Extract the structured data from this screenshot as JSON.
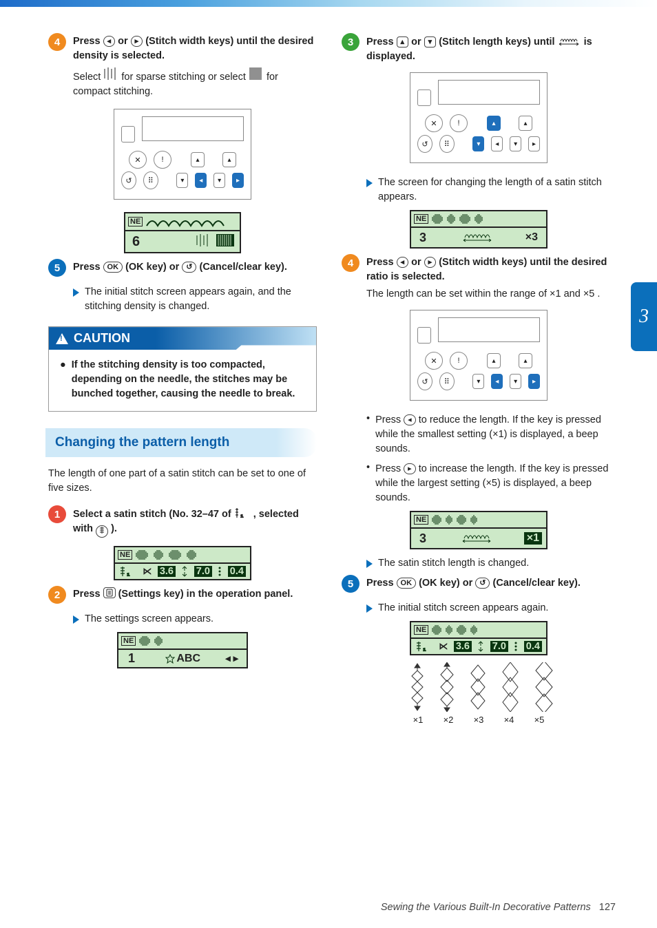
{
  "title": "Sewing machine manual page",
  "side_tab": "3",
  "footer": {
    "text": "Sewing the Various Built-In Decorative Patterns",
    "page": "127"
  },
  "left": {
    "step4": {
      "head_a": "Press ",
      "head_b": " or ",
      "head_c": " (Stitch width keys) until the desired density is selected.",
      "body_a": "Select ",
      "body_b": " for sparse stitching or select ",
      "body_c": " for compact stitching."
    },
    "lcd_density": {
      "label": "NE",
      "value": "6"
    },
    "step5": {
      "head_a": "Press ",
      "head_b": " (OK key) or ",
      "head_c": " (Cancel/clear key).",
      "ok": "OK",
      "cancel": "↺"
    },
    "step5_result": "The initial stitch screen appears again, and the stitching density is changed.",
    "caution": {
      "title": "CAUTION",
      "item1": "If the stitching density is too compacted, depending on the needle, the stitches may be bunched together, causing the needle to break."
    },
    "section_title": "Changing the pattern length",
    "intro": "The length of one part of a satin stitch can be set to one of five sizes.",
    "r_step1": {
      "head_a": "Select a satin stitch (No. 32–47 of ",
      "head_b": " , selected with ",
      "head_c": " )."
    },
    "lcd_stitch": {
      "label": "NE",
      "val_a": "3.6",
      "val_b": "7.0",
      "val_c": "0.4"
    },
    "r_step2": {
      "head_a": "Press ",
      "head_b": " (Settings key) in the operation panel."
    },
    "r_step2_result": "The settings screen appears.",
    "lcd_settings": {
      "label": "NE",
      "row": "1",
      "text": "ABC"
    }
  },
  "right": {
    "step3": {
      "head_a": "Press ",
      "head_b": " or ",
      "head_c": " (Stitch length keys) until ",
      "head_d": " is displayed."
    },
    "step3_result": "The screen for changing the length of a satin stitch appears.",
    "lcd_len1": {
      "label": "NE",
      "row": "3",
      "tag": "×3"
    },
    "step4": {
      "head_a": "Press ",
      "head_b": " or ",
      "head_c": " (Stitch width keys) until the desired ratio is selected.",
      "body_a": "The length can be set within the range of ",
      "body_b": " and ",
      "body_c": ".",
      "x1": "×1",
      "x5": "×5"
    },
    "bullet_left_a": "Press ",
    "bullet_left_b": " to reduce the length. If the key is pressed while the smallest setting (×1) is displayed, a beep sounds.",
    "bullet_right_a": "Press ",
    "bullet_right_b": " to increase the length. If the key is pressed while the largest setting (×5) is displayed, a beep sounds.",
    "lcd_len2": {
      "label": "NE",
      "row": "3",
      "tag": "×1"
    },
    "len_changed": "The satin stitch length is changed.",
    "step5": {
      "head_a": "Press ",
      "head_b": " (OK key) or ",
      "head_c": " (Cancel/clear key).",
      "ok": "OK",
      "cancel": "↺"
    },
    "step5_result": "The initial stitch screen appears again.",
    "scale": {
      "x1": "×1",
      "x2": "×2",
      "x3": "×3",
      "x4": "×4",
      "x5": "×5"
    }
  }
}
